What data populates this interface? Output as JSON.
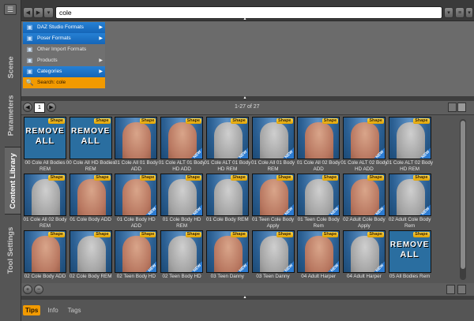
{
  "sidebar": {
    "menu_icon": "menu-icon",
    "tabs": [
      {
        "label": "Scene",
        "active": false
      },
      {
        "label": "Parameters",
        "active": false
      },
      {
        "label": "Content Library",
        "active": true
      },
      {
        "label": "Tool Settings",
        "active": false
      }
    ]
  },
  "toolbar": {
    "search_value": "cole",
    "icons": [
      "back-arrow-icon",
      "forward-arrow-icon",
      "history-icon",
      "search-dropdown-icon",
      "database-icon",
      "options-icon"
    ]
  },
  "categories": [
    {
      "label": "DAZ Studio Formats",
      "style": "blue",
      "icon": "cube-icon",
      "arrow": true
    },
    {
      "label": "Poser Formats",
      "style": "blue",
      "icon": "cube-icon",
      "arrow": true
    },
    {
      "label": "Other Import Formats",
      "style": "grey",
      "icon": "cube-icon",
      "arrow": false
    },
    {
      "label": "Products",
      "style": "grey",
      "icon": "box-icon",
      "arrow": true
    },
    {
      "label": "Categories",
      "style": "blue",
      "icon": "cube-icon",
      "arrow": true
    },
    {
      "label": "Search: cole",
      "style": "orange",
      "icon": "magnifier-icon",
      "arrow": false
    }
  ],
  "pager": {
    "page": "1",
    "range": "1-27 of 27"
  },
  "colors": {
    "accent_orange": "#f29a00",
    "category_blue": "#1e74c8",
    "shape_badge": "#f2c230"
  },
  "items": [
    {
      "label": "00 Cole All Bodies REM",
      "thumb": "remove",
      "new": false
    },
    {
      "label": "00 Cole All HD Bodies REM",
      "thumb": "remove",
      "new": false
    },
    {
      "label": "01 Cole All 01 Body ADD",
      "thumb": "tan",
      "new": false
    },
    {
      "label": "01 Cole ALT 01 Body HD ADD",
      "thumb": "tan",
      "new": true
    },
    {
      "label": "01 Cole ALT 01 Body HD REM",
      "thumb": "gray",
      "new": true
    },
    {
      "label": "01 Cole All 01 Body REM",
      "thumb": "gray",
      "new": true
    },
    {
      "label": "01 Cole All 02 Body ADD",
      "thumb": "tan",
      "new": false
    },
    {
      "label": "01 Cole ALT 02 Body HD ADD",
      "thumb": "tan",
      "new": true
    },
    {
      "label": "01 Cole ALT 02 Body HD REM",
      "thumb": "gray",
      "new": true
    },
    {
      "label": "01 Cole All 02 Body REM",
      "thumb": "gray",
      "new": false
    },
    {
      "label": "01 Cole Body ADD",
      "thumb": "tan",
      "new": false
    },
    {
      "label": "01 Cole Body HD ADD",
      "thumb": "tan",
      "new": true
    },
    {
      "label": "01 Cole Body HD REM",
      "thumb": "gray",
      "new": true
    },
    {
      "label": "01 Cole Body REM",
      "thumb": "gray",
      "new": false
    },
    {
      "label": "01 Teen Cole Body Apply",
      "thumb": "tan",
      "new": true
    },
    {
      "label": "01 Teen Cole Body Rem",
      "thumb": "gray",
      "new": true
    },
    {
      "label": "02 Adult Cole Body Apply",
      "thumb": "tan",
      "new": true
    },
    {
      "label": "02 Adult Cole Body Rem",
      "thumb": "gray",
      "new": true
    },
    {
      "label": "02 Cole Body ADD",
      "thumb": "tan",
      "new": false
    },
    {
      "label": "02 Cole Body REM",
      "thumb": "gray",
      "new": false
    },
    {
      "label": "02 Teen Body HD",
      "thumb": "tan",
      "new": true
    },
    {
      "label": "02 Teen Body HD",
      "thumb": "gray",
      "new": true
    },
    {
      "label": "03 Teen Danny",
      "thumb": "tan",
      "new": true
    },
    {
      "label": "03 Teen Danny",
      "thumb": "gray",
      "new": true
    },
    {
      "label": "04 Adult Harper",
      "thumb": "tan",
      "new": true
    },
    {
      "label": "04 Adult Harper",
      "thumb": "gray",
      "new": true
    },
    {
      "label": "05 All Bodies Rem",
      "thumb": "remove",
      "new": false
    }
  ],
  "tile_badge": "Shape",
  "new_badge": "NEW",
  "remove_text": "REMOVE ALL",
  "bottom_tabs": [
    {
      "label": "Tips",
      "active": true
    },
    {
      "label": "Info",
      "active": false
    },
    {
      "label": "Tags",
      "active": false
    }
  ]
}
